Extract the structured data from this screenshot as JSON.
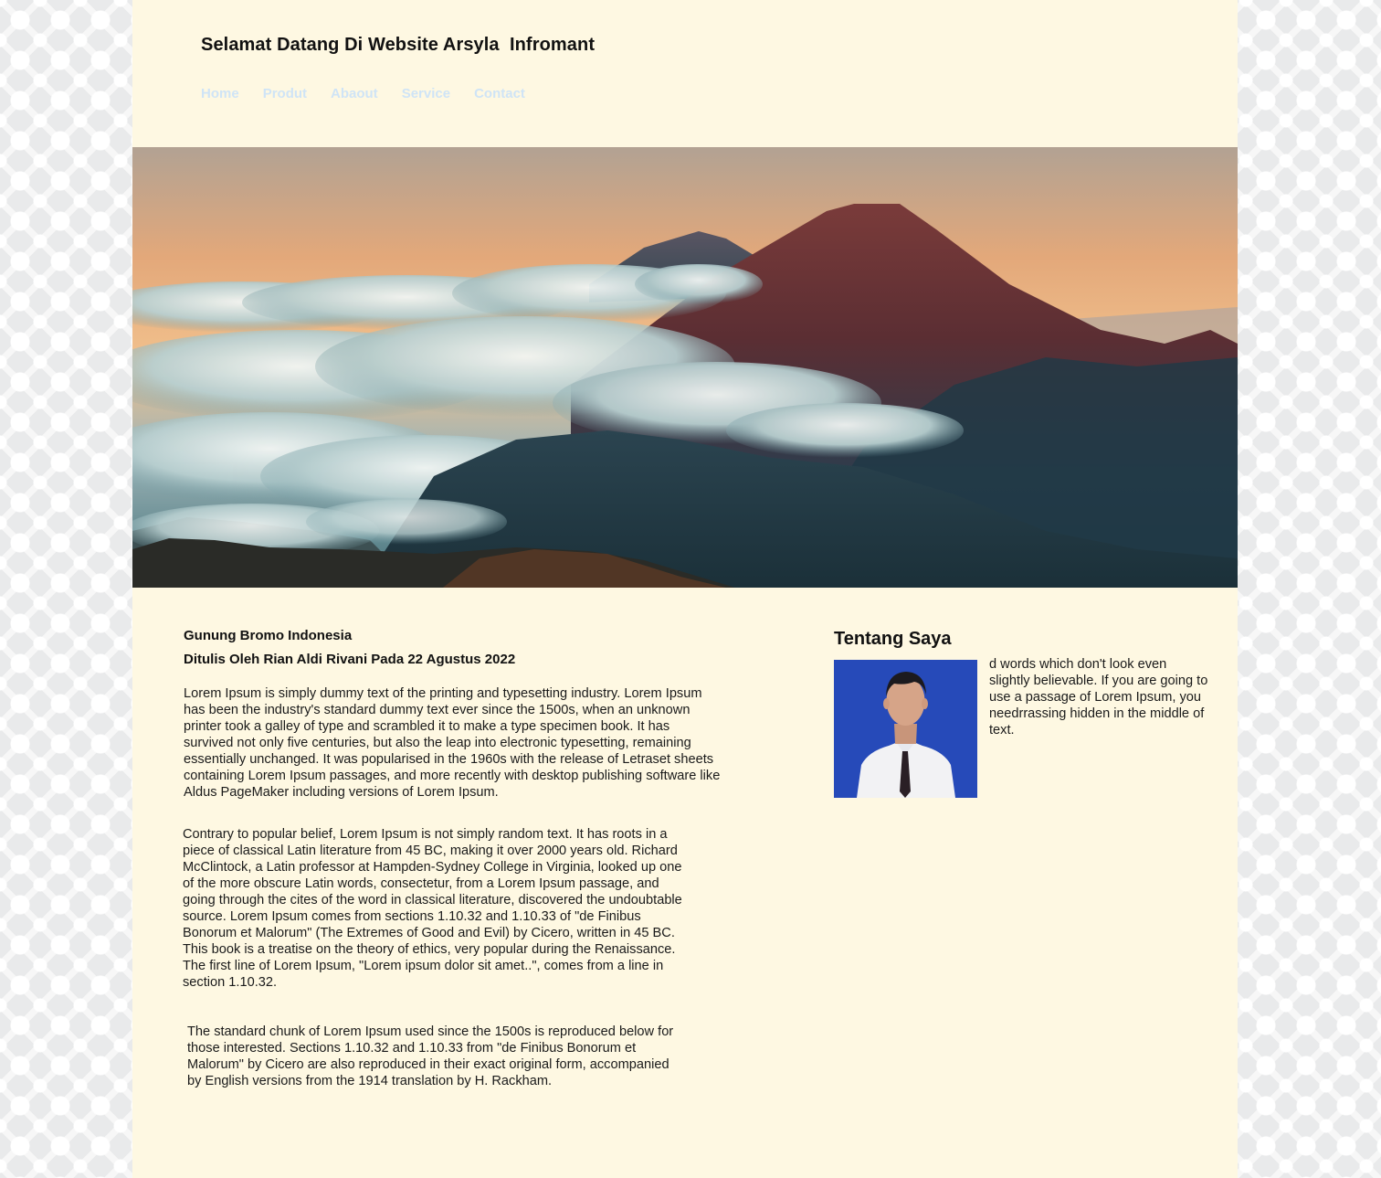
{
  "header": {
    "title": "Selamat Datang Di Website Arsyla  Infromant"
  },
  "nav": {
    "items": [
      "Home",
      "Produt",
      "Abaout",
      "Service",
      "Contact"
    ]
  },
  "article": {
    "title": "Gunung Bromo Indonesia",
    "meta": "Ditulis Oleh Rian Aldi Rivani Pada 22 Agustus 2022",
    "paragraphs": [
      "Lorem Ipsum is simply dummy text of the printing and typesetting industry. Lorem Ipsum has been the industry's standard dummy text ever since the 1500s, when an unknown printer took a galley of type and scrambled it to make a type specimen book. It has survived not only five centuries, but also the leap into electronic typesetting, remaining essentially unchanged. It was popularised in the 1960s with the release of Letraset sheets containing Lorem Ipsum passages, and more recently with desktop publishing software like Aldus PageMaker including versions of Lorem Ipsum.",
      "Contrary to popular belief, Lorem Ipsum is not simply random text. It has roots in a piece of classical Latin literature from 45 BC, making it over 2000 years old. Richard McClintock, a Latin professor at Hampden-Sydney College in Virginia, looked up one of the more obscure Latin words, consectetur, from a Lorem Ipsum passage, and going through the cites of the word in classical literature, discovered the undoubtable source. Lorem Ipsum comes from sections 1.10.32 and 1.10.33 of \"de Finibus Bonorum et Malorum\" (The Extremes of Good and Evil) by Cicero, written in 45 BC. This book is a treatise on the theory of ethics, very popular during the Renaissance. The first line of Lorem Ipsum, \"Lorem ipsum dolor sit amet..\", comes from a line in section 1.10.32.",
      "The standard chunk of Lorem Ipsum used since the 1500s is reproduced below for those interested. Sections 1.10.32 and 1.10.33 from \"de Finibus Bonorum et Malorum\" by Cicero are also reproduced in their exact original form, accompanied by English versions from the 1914 translation by H. Rackham."
    ]
  },
  "aside": {
    "title": "Tentang Saya",
    "text": "d words which don't look even slightly believable. If you are going to use a passage of Lorem Ipsum, you needrrassing hidden in the middle of text."
  },
  "colors": {
    "page_background": "#fef8e2",
    "nav_link": "#cfe4f6",
    "text": "#111111",
    "profile_backdrop": "#2a4fc0"
  }
}
